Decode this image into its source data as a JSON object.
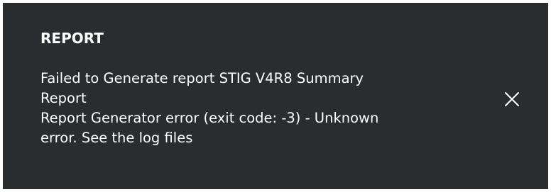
{
  "notification": {
    "title": "REPORT",
    "message_lines": [
      "Failed to Generate report STIG V4R8 Summary",
      "Report",
      "Report Generator error (exit code: -3) - Unknown",
      "error. See the log files"
    ],
    "close_icon": "close-icon",
    "colors": {
      "background": "#2a2d2f",
      "text": "#ffffff"
    }
  }
}
